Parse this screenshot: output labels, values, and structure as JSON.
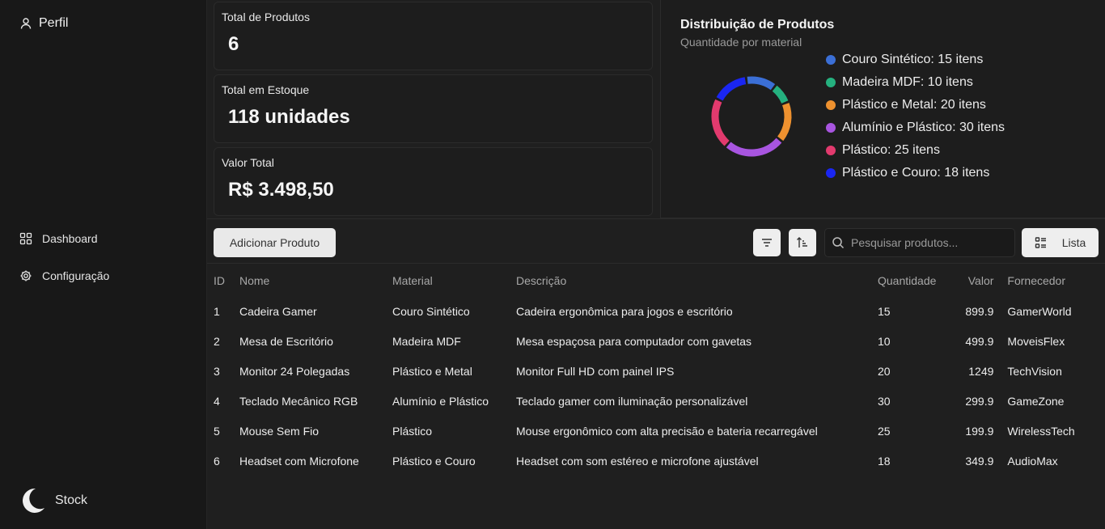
{
  "sidebar": {
    "profile_label": "Perfil",
    "nav": [
      {
        "label": "Dashboard",
        "icon": "grid-icon"
      },
      {
        "label": "Configuração",
        "icon": "gear-icon"
      }
    ],
    "brand_label": "Stock",
    "brand_icon": "moon-icon"
  },
  "stats": {
    "total_products_label": "Total de Produtos",
    "total_products_value": "6",
    "total_stock_label": "Total em Estoque",
    "total_stock_value": "118 unidades",
    "total_value_label": "Valor Total",
    "total_value_value": "R$ 3.498,50"
  },
  "chart": {
    "title": "Distribuição de Produtos",
    "subtitle": "Quantidade por material"
  },
  "chart_data": {
    "type": "pie",
    "title": "Distribuição de Produtos",
    "subtitle": "Quantidade por material",
    "legend_position": "right",
    "series": [
      {
        "name": "Couro Sintético",
        "value": 15,
        "label": "Couro Sintético: 15 itens",
        "color": "#3b6fd6"
      },
      {
        "name": "Madeira MDF",
        "value": 10,
        "label": "Madeira MDF: 10 itens",
        "color": "#25b17f"
      },
      {
        "name": "Plástico e Metal",
        "value": 20,
        "label": "Plástico e Metal: 20 itens",
        "color": "#ee912f"
      },
      {
        "name": "Alumínio e Plástico",
        "value": 30,
        "label": "Alumínio e Plástico: 30 itens",
        "color": "#a855e0"
      },
      {
        "name": "Plástico",
        "value": 25,
        "label": "Plástico: 25 itens",
        "color": "#e23a6e"
      },
      {
        "name": "Plástico e Couro",
        "value": 18,
        "label": "Plástico e Couro: 18 itens",
        "color": "#1a26f2"
      }
    ]
  },
  "toolbar": {
    "add_label": "Adicionar Produto",
    "search_placeholder": "Pesquisar produtos...",
    "view_label": "Lista"
  },
  "table": {
    "headers": [
      "ID",
      "Nome",
      "Material",
      "Descrição",
      "Quantidade",
      "Valor",
      "Fornecedor"
    ],
    "rows": [
      [
        "1",
        "Cadeira Gamer",
        "Couro Sintético",
        "Cadeira ergonômica para jogos e escritório",
        "15",
        "899.9",
        "GamerWorld"
      ],
      [
        "2",
        "Mesa de Escritório",
        "Madeira MDF",
        "Mesa espaçosa para computador com gavetas",
        "10",
        "499.9",
        "MoveisFlex"
      ],
      [
        "3",
        "Monitor 24 Polegadas",
        "Plástico e Metal",
        "Monitor Full HD com painel IPS",
        "20",
        "1249",
        "TechVision"
      ],
      [
        "4",
        "Teclado Mecânico RGB",
        "Alumínio e Plástico",
        "Teclado gamer com iluminação personalizável",
        "30",
        "299.9",
        "GameZone"
      ],
      [
        "5",
        "Mouse Sem Fio",
        "Plástico",
        "Mouse ergonômico com alta precisão e bateria recarregável",
        "25",
        "199.9",
        "WirelessTech"
      ],
      [
        "6",
        "Headset com Microfone",
        "Plástico e Couro",
        "Headset com som estéreo e microfone ajustável",
        "18",
        "349.9",
        "AudioMax"
      ]
    ]
  }
}
